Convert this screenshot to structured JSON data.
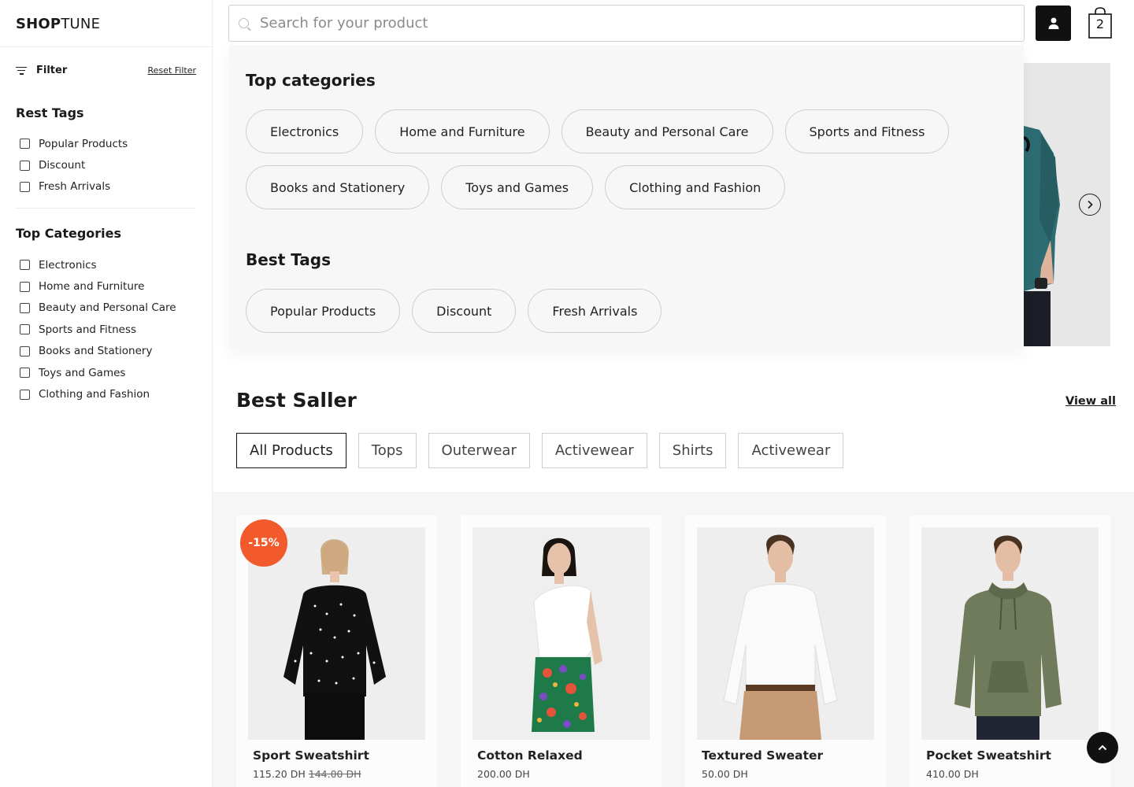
{
  "brand": {
    "bold": "SHOP",
    "light": "TUNE"
  },
  "search": {
    "placeholder": "Search for your product"
  },
  "header": {
    "cart_count": "2"
  },
  "sidebar": {
    "filter_label": "Filter",
    "reset_label": "Reset Filter",
    "rest_tags_title": "Rest Tags",
    "rest_tags": [
      "Popular Products",
      "Discount",
      "Fresh Arrivals"
    ],
    "top_categories_title": "Top Categories",
    "top_categories": [
      "Electronics",
      "Home and Furniture",
      "Beauty and Personal Care",
      "Sports and Fitness",
      "Books and Stationery",
      "Toys and Games",
      "Clothing and Fashion"
    ]
  },
  "dropdown": {
    "top_categories_title": "Top categories",
    "categories_row1": [
      "Electronics",
      "Home and Furniture",
      "Beauty and Personal Care",
      "Sports and Fitness"
    ],
    "categories_row2": [
      "Books and Stationery",
      "Toys and Games",
      "Clothing and Fashion"
    ],
    "best_tags_title": "Best Tags",
    "tags": [
      "Popular Products",
      "Discount",
      "Fresh Arrivals"
    ]
  },
  "best_seller": {
    "title": "Best Saller",
    "view_all": "View all",
    "tabs": [
      "All Products",
      "Tops",
      "Outerwear",
      "Activewear",
      "Shirts",
      "Activewear"
    ]
  },
  "products": [
    {
      "name": "Sport Sweatshirt",
      "price": "115.20 DH",
      "old_price": "144.00 DH",
      "badge": "-15%"
    },
    {
      "name": "Cotton Relaxed",
      "price": "200.00 DH"
    },
    {
      "name": "Textured Sweater",
      "price": "50.00 DH"
    },
    {
      "name": "Pocket Sweatshirt",
      "price": "410.00 DH"
    }
  ],
  "colors": {
    "accent": "#f25a2b",
    "dark": "#111111",
    "dropdown_bg": "#f7f7f7"
  }
}
